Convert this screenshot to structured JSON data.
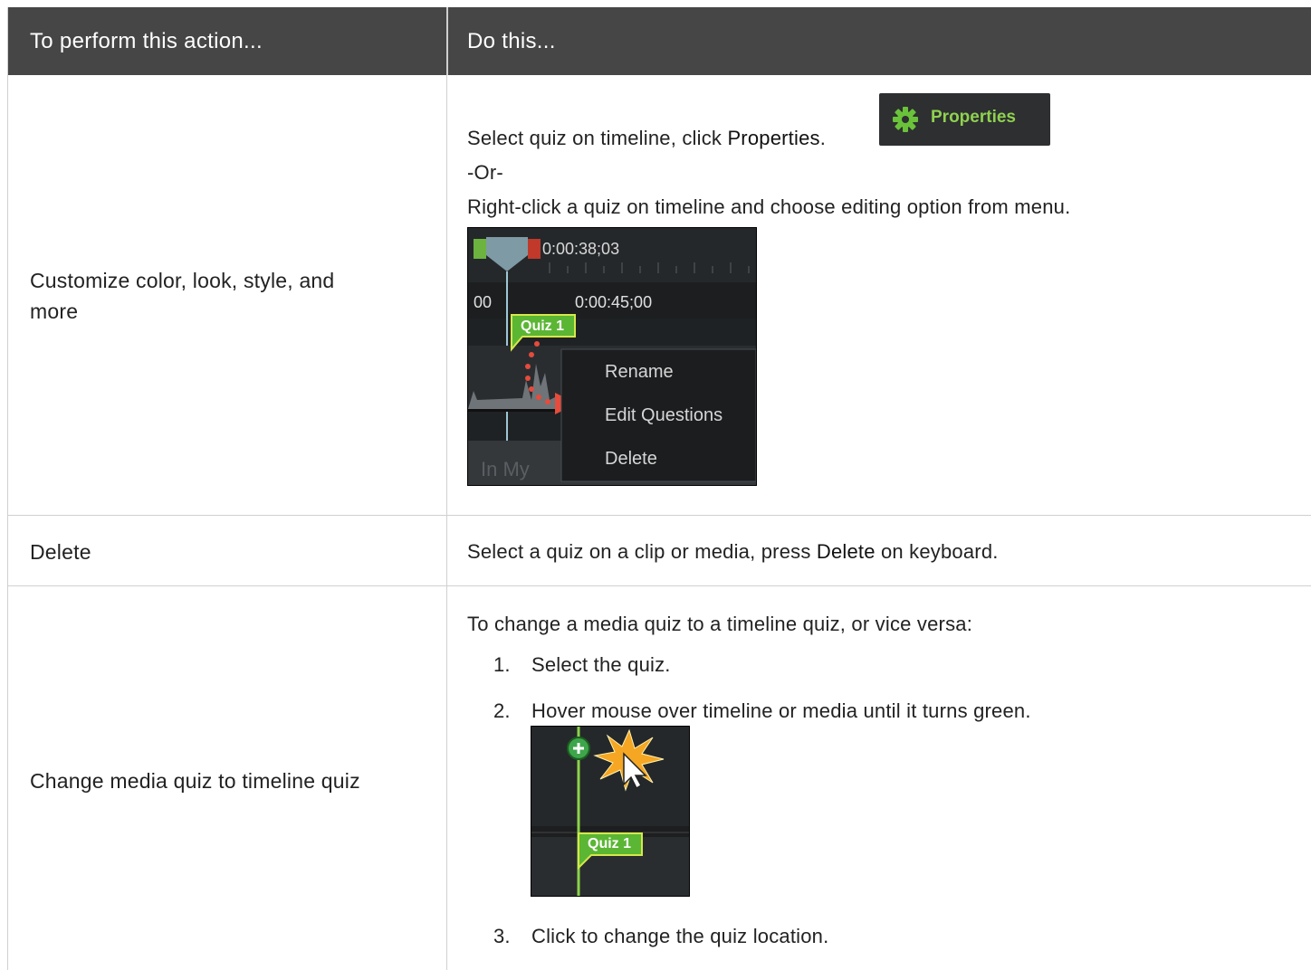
{
  "header": {
    "col1": "To perform this action...",
    "col2": "Do this..."
  },
  "row1": {
    "action_line1": "Customize color, look, style, and",
    "action_line2": "more",
    "step_prefix": "Select quiz on timeline, click ",
    "step_bold": "Properties",
    "step_suffix": ".",
    "or": "-Or-",
    "alt": "Right-click a quiz on timeline and choose editing option from menu.",
    "properties_button": "Properties",
    "timeline": {
      "time_top": "0:00:38;03",
      "time_left": "00",
      "time_mid": "0:00:45;00",
      "marker": "Quiz 1",
      "menu": [
        "Rename",
        "Edit Questions",
        "Delete"
      ],
      "track_text": "In  My"
    }
  },
  "row2": {
    "action": "Delete",
    "text_prefix": "Select a quiz on a clip or media, press ",
    "text_bold": "Delete",
    "text_suffix": " on keyboard."
  },
  "row3": {
    "action": "Change media quiz to timeline quiz",
    "intro": "To change a media quiz to a timeline quiz, or vice versa:",
    "steps": [
      "Select the quiz.",
      "Hover mouse over timeline or media until it turns green.",
      "Click to change the quiz location."
    ],
    "marker": "Quiz 1"
  },
  "colors": {
    "header_bg": "#464646",
    "accent_green": "#8fd14f",
    "marker_green": "#5bb634"
  }
}
